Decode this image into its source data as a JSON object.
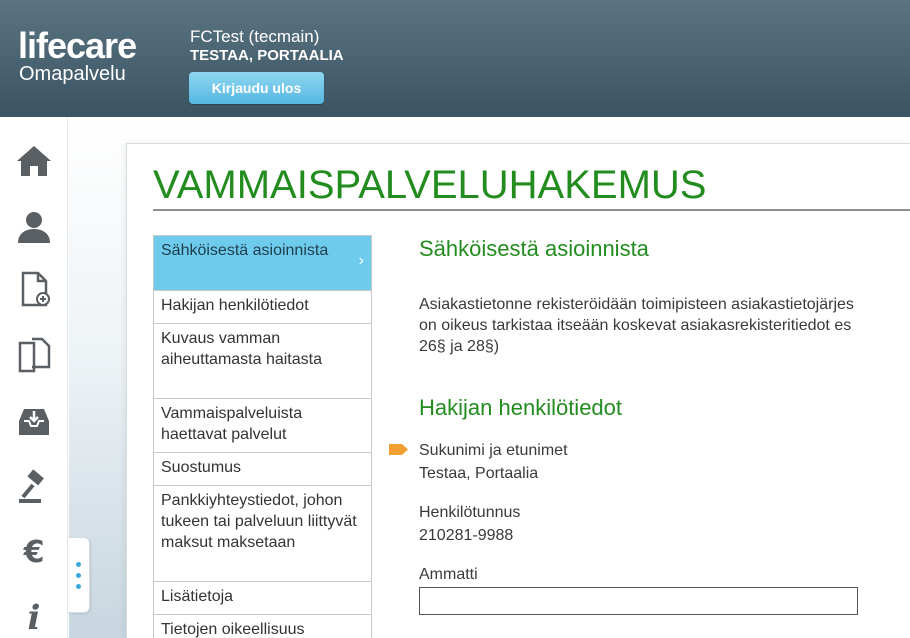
{
  "header": {
    "logo_main": "lifecare",
    "logo_sub": "Omapalvelu",
    "user_name": "FCTest (tecmain)",
    "user_fullname": "TESTAA, PORTAALIA",
    "logout_label": "Kirjaudu ulos"
  },
  "iconbar": {
    "icons": [
      "home-icon",
      "user-icon",
      "new-document-icon",
      "documents-icon",
      "inbox-icon",
      "gavel-icon",
      "euro-icon",
      "info-icon"
    ]
  },
  "colors": {
    "accent_green": "#228c1f",
    "active_blue": "#6ecbeb",
    "header_bg": "#465f6d",
    "required_marker": "#f0a030"
  },
  "page": {
    "title": "VAMMAISPALVELUHAKEMUS"
  },
  "secnav": {
    "items": [
      {
        "label": "Sähköisestä asioinnista"
      },
      {
        "label": "Hakijan henkilötiedot"
      },
      {
        "label": "Kuvaus vamman aiheuttamasta haitasta"
      },
      {
        "label": "Vammaispalveluista haettavat palvelut"
      },
      {
        "label": "Suostumus"
      },
      {
        "label": "Pankkiyhteystiedot, johon tukeen tai palveluun liittyvät maksut maksetaan"
      },
      {
        "label": "Lisätietoja"
      },
      {
        "label": "Tietojen oikeellisuus"
      }
    ]
  },
  "content": {
    "section1_title": "Sähköisestä asioinnista",
    "section1_lines": [
      "Asiakastietonne rekisteröidään toimipisteen asiakastietojärjes",
      "on oikeus tarkistaa itseään koskevat asiakasrekisteritiedot es",
      "26§ ja 28§)"
    ],
    "section2_title": "Hakijan henkilötiedot",
    "fields": {
      "name_label": "Sukunimi ja etunimet",
      "name_value": "Testaa, Portaalia",
      "ssn_label": "Henkilötunnus",
      "ssn_value": "210281-9988",
      "occupation_label": "Ammatti",
      "occupation_value": ""
    }
  }
}
